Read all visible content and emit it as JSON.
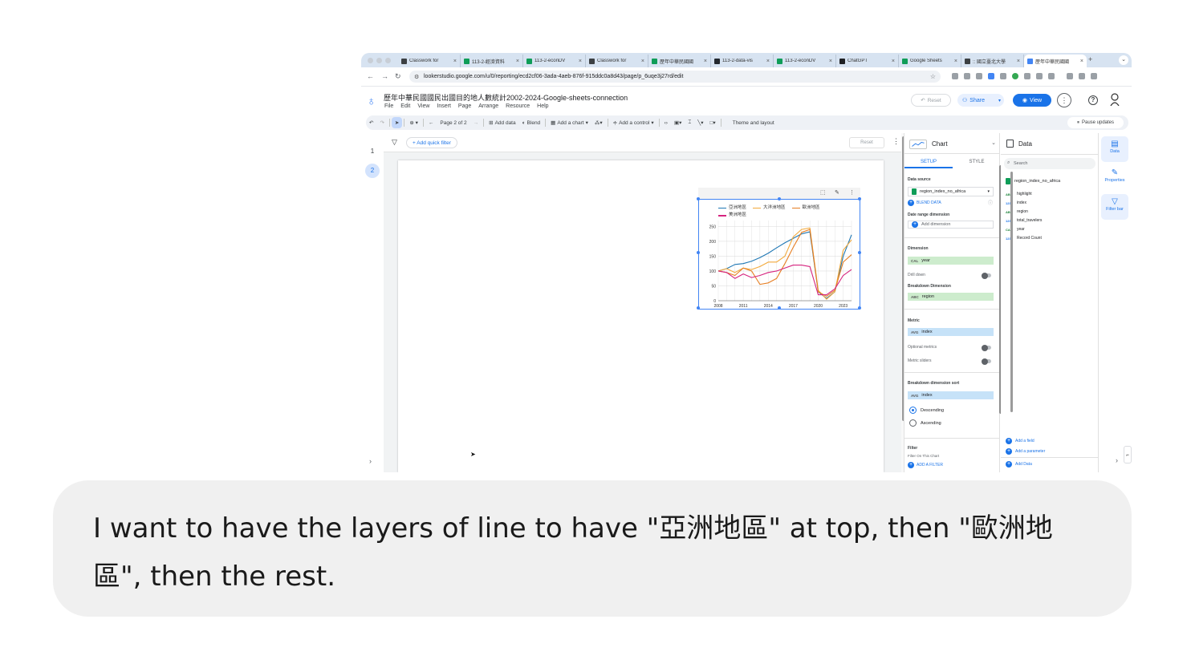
{
  "browser": {
    "tabs": [
      {
        "label": "Classwork for",
        "icon": "classroom-icon",
        "color": "#3c4043"
      },
      {
        "label": "113-2-經濟資料",
        "icon": "sheets-icon",
        "color": "#0f9d58"
      },
      {
        "label": "113-2-econDV",
        "icon": "sheets-icon",
        "color": "#0f9d58"
      },
      {
        "label": "Classwork for",
        "icon": "classroom-icon",
        "color": "#3c4043"
      },
      {
        "label": "歷年中華民國國",
        "icon": "sheets-icon",
        "color": "#0f9d58"
      },
      {
        "label": "113-2-data-vis",
        "icon": "github-icon",
        "color": "#24292f"
      },
      {
        "label": "113-2-econDV",
        "icon": "sheets-icon",
        "color": "#0f9d58"
      },
      {
        "label": "ChatGPT",
        "icon": "chatgpt-icon",
        "color": "#202124"
      },
      {
        "label": "Google Sheets",
        "icon": "sheets-icon",
        "color": "#0f9d58"
      },
      {
        "label": ":: 國立臺北大學",
        "icon": "university-icon",
        "color": "#3c4043"
      },
      {
        "label": "歷年中華民國國",
        "icon": "looker-icon",
        "color": "#4285f4"
      }
    ],
    "new_tab": "+",
    "url": "lookerstudio.google.com/u/0/reporting/ecd2cf06-3ada-4aeb-876f-915ddc0a8d43/page/p_6uqe3j27rd/edit"
  },
  "app": {
    "title": "歷年中華民國國民出國目的地人數統計2002-2024-Google-sheets-connection",
    "menus": [
      "File",
      "Edit",
      "View",
      "Insert",
      "Page",
      "Arrange",
      "Resource",
      "Help"
    ],
    "reset_label": "Reset",
    "share_label": "Share",
    "view_label": "View"
  },
  "toolbar": {
    "page_label": "Page 2 of 2",
    "add_data": "Add data",
    "blend": "Blend",
    "add_chart": "Add a chart",
    "add_control": "Add a control",
    "theme_layout": "Theme and layout",
    "pause_updates": "Pause updates"
  },
  "pages": [
    "1",
    "2"
  ],
  "canvas": {
    "quick_filter": "+ Add quick filter",
    "reset_label": "Reset"
  },
  "chart_data": {
    "type": "line",
    "x": [
      2008,
      2009,
      2010,
      2011,
      2012,
      2013,
      2014,
      2015,
      2016,
      2017,
      2018,
      2019,
      2020,
      2021,
      2022,
      2023,
      2024
    ],
    "x_ticks": [
      "2008",
      "2011",
      "2014",
      "2017",
      "2020",
      "2023"
    ],
    "y_ticks": [
      "0",
      "50",
      "100",
      "150",
      "200",
      "250"
    ],
    "ylim": [
      0,
      270
    ],
    "grid": true,
    "legend_position": "top",
    "series": [
      {
        "name": "亞洲地區",
        "color": "#1f77b4",
        "values": [
          100,
          108,
          122,
          125,
          133,
          145,
          160,
          178,
          195,
          210,
          225,
          232,
          30,
          8,
          30,
          150,
          222
        ]
      },
      {
        "name": "大洋洲地區",
        "color": "#f2a93b",
        "values": [
          100,
          108,
          95,
          110,
          105,
          115,
          130,
          130,
          150,
          215,
          240,
          245,
          35,
          5,
          30,
          170,
          205
        ]
      },
      {
        "name": "歐洲地區",
        "color": "#e67e22",
        "values": [
          100,
          95,
          85,
          110,
          100,
          55,
          60,
          75,
          125,
          180,
          230,
          240,
          30,
          15,
          35,
          130,
          155
        ]
      },
      {
        "name": "美洲地區",
        "color": "#d6247f",
        "values": [
          100,
          95,
          75,
          90,
          78,
          85,
          95,
          100,
          110,
          120,
          120,
          115,
          20,
          20,
          40,
          85,
          105
        ]
      }
    ]
  },
  "setup_panel": {
    "title": "Chart",
    "tab_setup": "SETUP",
    "tab_style": "STYLE",
    "data_source_label": "Data source",
    "data_source_value": "region_index_no_africa",
    "blend_data": "BLEND DATA",
    "date_range_label": "Date range dimension",
    "add_dimension": "Add dimension",
    "dimension_label": "Dimension",
    "dimension_value": "year",
    "drill_down": "Drill down",
    "breakdown_label": "Breakdown Dimension",
    "breakdown_value": "region",
    "metric_label": "Metric",
    "metric_value": "index",
    "optional_metrics": "Optional metrics",
    "metric_sliders": "Metric sliders",
    "breakdown_sort_label": "Breakdown dimension sort",
    "breakdown_sort_value": "index",
    "descending": "Descending",
    "ascending": "Ascending",
    "filter_label": "Filter",
    "filter_on_chart": "Filter On This Chart",
    "add_filter": "ADD A FILTER",
    "type_date": "CAL",
    "type_text": "ABC",
    "type_num": "AVG"
  },
  "data_panel": {
    "title": "Data",
    "search_placeholder": "Search",
    "source": "region_index_no_africa",
    "fields": [
      {
        "type": "ABC",
        "name": "highlight"
      },
      {
        "type": "123",
        "name": "index"
      },
      {
        "type": "ABC",
        "name": "region"
      },
      {
        "type": "123",
        "name": "total_travelers"
      },
      {
        "type": "CAL",
        "name": "year"
      },
      {
        "type": "123",
        "name": "Record Count"
      }
    ],
    "add_field": "Add a field",
    "add_parameter": "Add a parameter",
    "add_data": "Add Data"
  },
  "rail": {
    "data": "Data",
    "properties": "Properties",
    "filter_bar": "Filter bar"
  },
  "instruction": "I want to have the layers of line to have \"亞洲地區\" at top, then \"歐洲地區\", then the rest."
}
